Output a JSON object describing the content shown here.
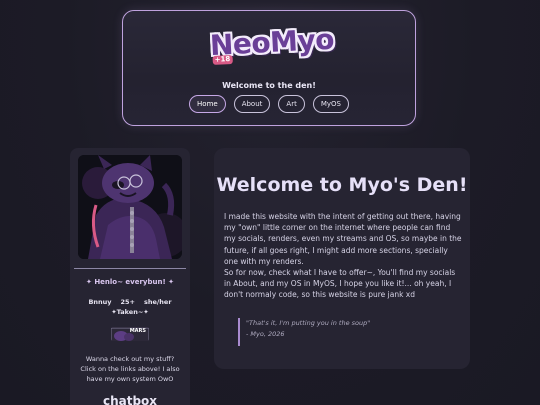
{
  "header": {
    "logo_text": "NeoMyo",
    "logo_badge": "+18",
    "welcome": "Welcome to the den!",
    "nav": [
      {
        "label": "Home",
        "active": true
      },
      {
        "label": "About",
        "active": false
      },
      {
        "label": "Art",
        "active": false
      },
      {
        "label": "MyOS",
        "active": false
      }
    ]
  },
  "sidebar": {
    "greeting": "✦ Henlo~ everybun! ✦",
    "info": [
      "Bnnuy",
      "25+",
      "she/her"
    ],
    "status": "✦Taken~✦",
    "badge_text": "MARS",
    "description": "Wanna check out my stuff? Click on the links above! I also have my own system OwO",
    "chatbox_title": "chatbox"
  },
  "main": {
    "title": "Welcome to Myo's Den!",
    "paragraph1": "I made this website with the intent of getting out there, having my \"own\" little corner on the internet where people can find my socials, renders, even my streams and OS, so maybe in the future, if all goes right, I might add more sections, specially one with my renders.",
    "paragraph2": "So for now, check what I have to offer~, You'll find my socials in About, and my OS in MyOS, I hope you like it!... oh yeah, I don't normaly code, so this website is pure jank xd",
    "quote_text": "\"That's it, I'm putting you in the soup\"",
    "quote_author": "- Myo, 2026"
  },
  "colors": {
    "background": "#1c1b26",
    "panel": "#262432",
    "accent": "#bfa2de",
    "logo_fill": "#6a3f97"
  }
}
